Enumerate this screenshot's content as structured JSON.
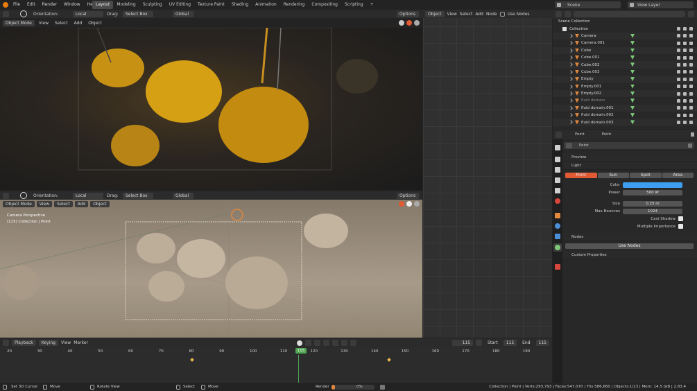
{
  "topbar": {
    "menus": [
      "File",
      "Edit",
      "Render",
      "Window",
      "Help"
    ],
    "workspaces": [
      "Layout",
      "Modeling",
      "Sculpting",
      "UV Editing",
      "Texture Paint",
      "Shading",
      "Animation",
      "Rendering",
      "Compositing",
      "Scripting"
    ],
    "active_workspace": "Layout",
    "add_tab": "+",
    "scene": "Scene",
    "view_layer": "View Layer"
  },
  "viewport_top": {
    "orientation_label": "Orientation:",
    "orientation_value": "Local",
    "drag_label": "Drag:",
    "drag_value": "Select Box",
    "transform_value": "Global",
    "options": "Options",
    "mode": "Object Mode",
    "menu_view": "View",
    "menu_select": "Select",
    "menu_add": "Add",
    "menu_object": "Object"
  },
  "viewport_bottom": {
    "orientation_label": "Orientation:",
    "orientation_value": "Local",
    "drag_label": "Drag:",
    "drag_value": "Select Box",
    "transform_value": "Global",
    "options": "Options",
    "mode": "Object Mode",
    "menu_view": "View",
    "menu_select": "Select",
    "menu_add": "Add",
    "menu_object": "Object",
    "overlay_line1": "Camera Perspective",
    "overlay_line2": "(115) Collection | Point"
  },
  "node_editor": {
    "options": "Options",
    "type": "Object",
    "menu_view": "View",
    "menu_select": "Select",
    "menu_add": "Add",
    "menu_node": "Node",
    "use_nodes": "Use Nodes"
  },
  "outliner": {
    "scene_collection": "Scene Collection",
    "collection": "Collection",
    "items": [
      {
        "name": "Camera",
        "icon_color": "#e2883c",
        "dimmed": false
      },
      {
        "name": "Camera.001",
        "icon_color": "#e2883c",
        "dimmed": false
      },
      {
        "name": "Cube",
        "icon_color": "#e2883c",
        "dimmed": false
      },
      {
        "name": "Cube.001",
        "icon_color": "#e2883c",
        "dimmed": false
      },
      {
        "name": "Cube.002",
        "icon_color": "#e2883c",
        "dimmed": false
      },
      {
        "name": "Cube.003",
        "icon_color": "#e2883c",
        "dimmed": false
      },
      {
        "name": "Empty",
        "icon_color": "#e2883c",
        "dimmed": false
      },
      {
        "name": "Empty.001",
        "icon_color": "#e2883c",
        "dimmed": false
      },
      {
        "name": "Empty.002",
        "icon_color": "#e2883c",
        "dimmed": false
      },
      {
        "name": "fluid domain",
        "icon_color": "#e2883c",
        "dimmed": true
      },
      {
        "name": "fluid domain.001",
        "icon_color": "#e2883c",
        "dimmed": false
      },
      {
        "name": "fluid domain.002",
        "icon_color": "#e2883c",
        "dimmed": false
      },
      {
        "name": "fluid domain.003",
        "icon_color": "#e2883c",
        "dimmed": false
      }
    ]
  },
  "properties": {
    "breadcrumb_1": "Point",
    "breadcrumb_2": "Point",
    "datablock_name": "Point",
    "preview": "Preview",
    "light": "Light",
    "light_types": [
      "Point",
      "Sun",
      "Spot",
      "Area"
    ],
    "active_light_type": "Point",
    "color_label": "Color",
    "color_value": "#3d9df0",
    "power_label": "Power",
    "power_value": "500 W",
    "size_label": "Size",
    "size_value": "0.25 m",
    "max_bounces_label": "Max Bounces",
    "max_bounces_value": "1024",
    "cast_shadow_label": "Cast Shadow",
    "multiple_importance_label": "Multiple Importance",
    "nodes": "Nodes",
    "use_nodes_button": "Use Nodes",
    "custom_properties": "Custom Properties"
  },
  "timeline": {
    "playback": "Playback",
    "keying": "Keying",
    "menu_view": "View",
    "menu_marker": "Marker",
    "current_frame": "115",
    "start_label": "Start",
    "start_value": "115",
    "end_label": "End",
    "end_value": "115",
    "ticks": [
      "20",
      "30",
      "40",
      "50",
      "60",
      "70",
      "80",
      "90",
      "100",
      "110",
      "115",
      "120",
      "130",
      "140",
      "150",
      "160",
      "170",
      "180",
      "190"
    ],
    "active_tick": "115"
  },
  "statusbar": {
    "set_cursor": "Set 3D Cursor",
    "move1": "Move",
    "rotate_view": "Rotate View",
    "select": "Select",
    "move2": "Move",
    "render_label": "Render",
    "render_progress": "0%",
    "stats": "Collection | Point | Verts:293,793 | Faces:547,070 | Tris:586,660 | Objects:1/23 | Mem: 14.5 GiB | 2.83.4"
  },
  "colors": {
    "accent_orange": "#e2883c",
    "active_light_btn": "#e05a33",
    "timeline_current": "#4fa653",
    "light_blue": "#3d9df0"
  }
}
